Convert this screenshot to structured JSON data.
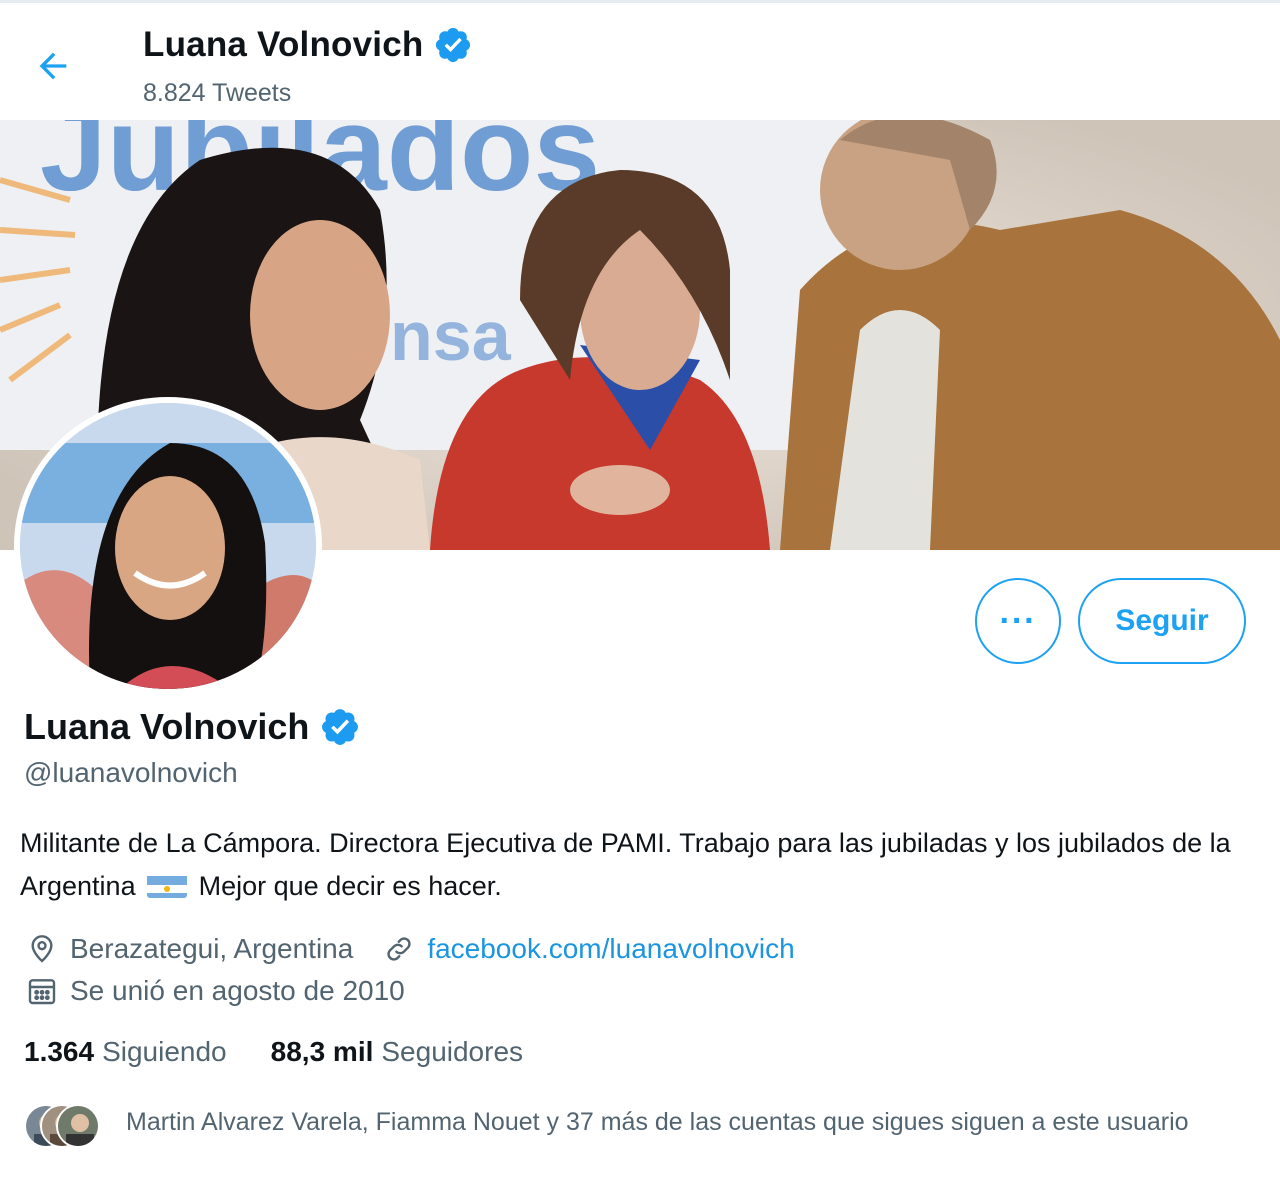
{
  "header": {
    "name": "Luana Volnovich",
    "tweet_count": "8.824 Tweets"
  },
  "profile": {
    "name": "Luana Volnovich",
    "handle": "@luanavolnovich",
    "bio_part1": "Militante de La Cámpora. Directora Ejecutiva de PAMI. Trabajo para las jubiladas y los jubilados de la Argentina",
    "bio_part2": "Mejor que decir es hacer.",
    "location": "Berazategui, Argentina",
    "website": "facebook.com/luanavolnovich",
    "joined": "Se unió en agosto de 2010"
  },
  "buttons": {
    "more_label": "···",
    "follow_label": "Seguir"
  },
  "stats": {
    "following_count": "1.364",
    "following_label": "Siguiendo",
    "followers_count": "88,3 mil",
    "followers_label": "Seguidores"
  },
  "followers_you_know": "Martin Alvarez Varela, Fiamma Nouet y 37 más de las cuentas que sigues siguen a este usuario",
  "banner_text": "Jubilados",
  "colors": {
    "accent": "#1da1f2",
    "link": "#1b95e0",
    "secondary_text": "#536471",
    "verified": "#1d9bf0"
  },
  "icons": {
    "back": "arrow-left-icon",
    "verified": "verified-badge-icon",
    "location": "location-pin-icon",
    "link": "link-icon",
    "calendar": "calendar-icon"
  }
}
